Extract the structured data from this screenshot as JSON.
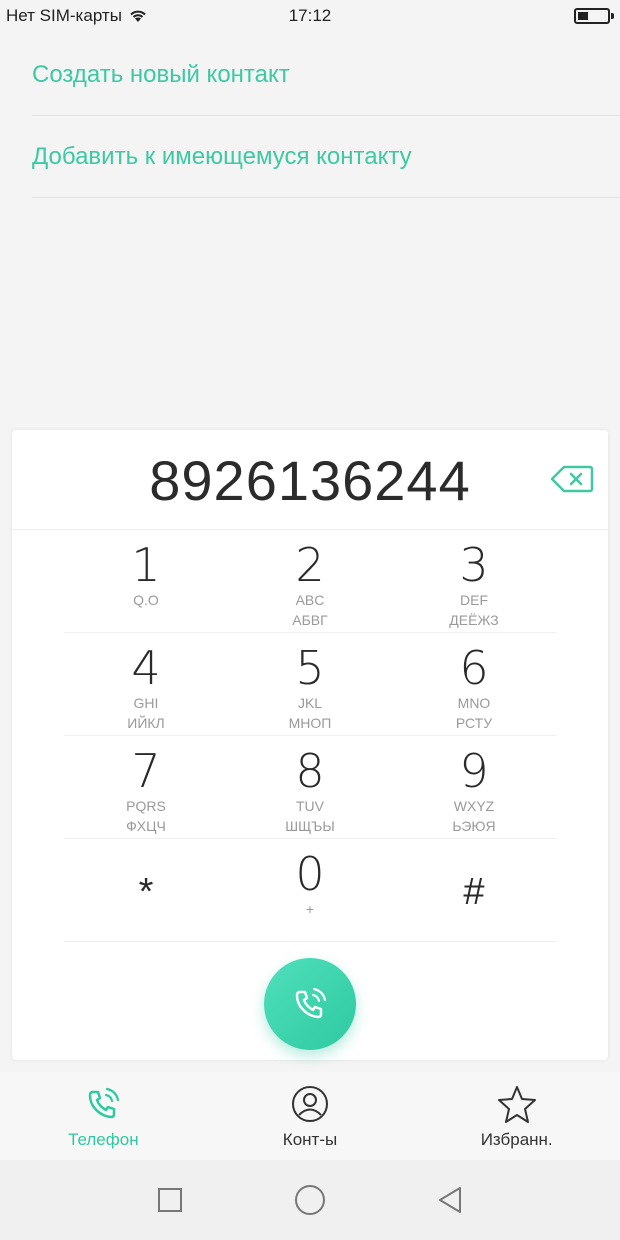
{
  "status": {
    "carrier": "Нет SIM-карты",
    "time": "17:12"
  },
  "menu": {
    "items": [
      {
        "label": "Создать новый контакт"
      },
      {
        "label": "Добавить к имеющемуся контакту"
      }
    ]
  },
  "dialer": {
    "number": "8926136244",
    "keys": [
      [
        {
          "digit": "1",
          "sub1": "Q.O",
          "sub2": ""
        },
        {
          "digit": "2",
          "sub1": "ABC",
          "sub2": "АБВГ"
        },
        {
          "digit": "3",
          "sub1": "DEF",
          "sub2": "ДЕЁЖЗ"
        }
      ],
      [
        {
          "digit": "4",
          "sub1": "GHI",
          "sub2": "ИЙКЛ"
        },
        {
          "digit": "5",
          "sub1": "JKL",
          "sub2": "МНОП"
        },
        {
          "digit": "6",
          "sub1": "MNO",
          "sub2": "РСТУ"
        }
      ],
      [
        {
          "digit": "7",
          "sub1": "PQRS",
          "sub2": "ФХЦЧ"
        },
        {
          "digit": "8",
          "sub1": "TUV",
          "sub2": "ШЩЪЫ"
        },
        {
          "digit": "9",
          "sub1": "WXYZ",
          "sub2": "ЬЭЮЯ"
        }
      ],
      [
        {
          "digit": "*"
        },
        {
          "digit": "0",
          "sub1": "+"
        },
        {
          "digit": "#"
        }
      ]
    ]
  },
  "tabs": [
    {
      "label": "Телефон",
      "icon": "phone-icon",
      "active": true
    },
    {
      "label": "Конт-ы",
      "icon": "contact-icon",
      "active": false
    },
    {
      "label": "Избранн.",
      "icon": "star-icon",
      "active": false
    }
  ],
  "colors": {
    "accent": "#2ec9a0",
    "link": "#3ec8a4"
  }
}
